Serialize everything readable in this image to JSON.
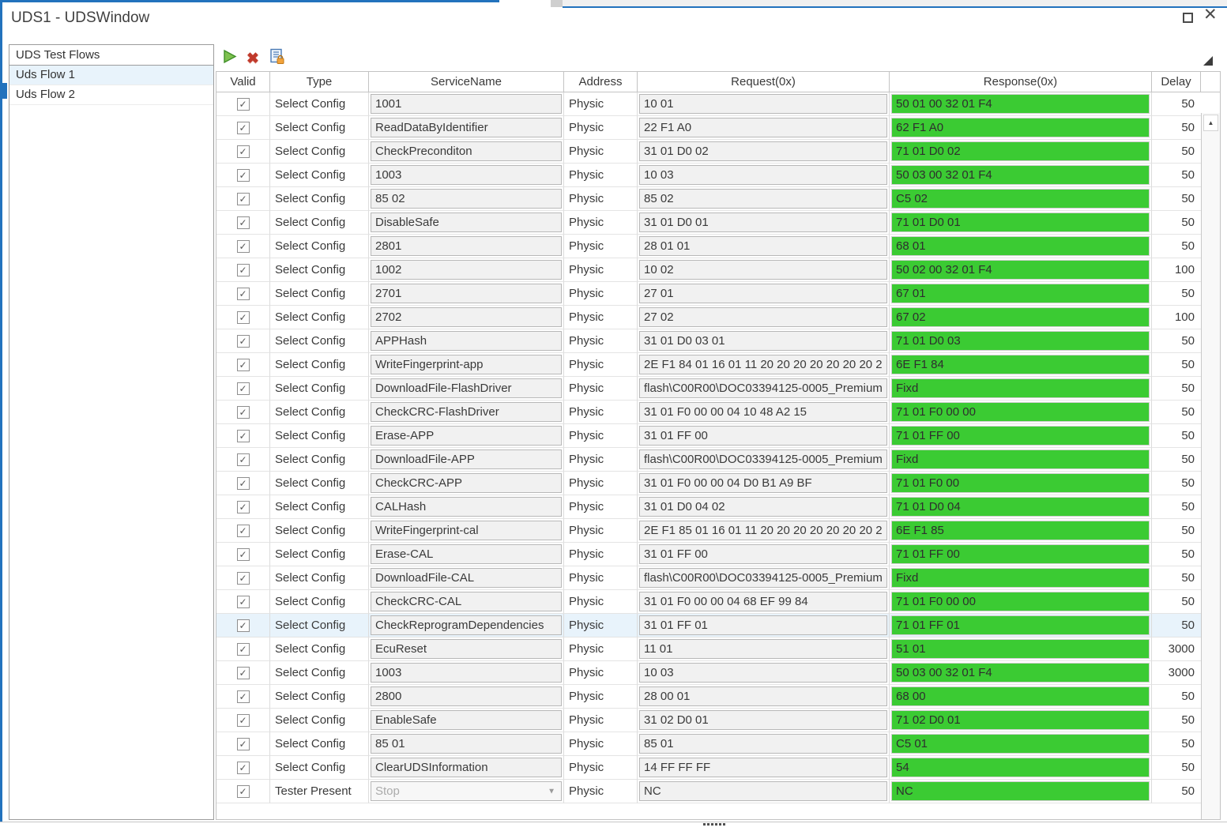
{
  "window": {
    "title": "UDS1 - UDSWindow",
    "close_glyph": "✕"
  },
  "sidebar": {
    "header": "UDS Test Flows",
    "items": [
      {
        "label": "Uds Flow 1",
        "selected": true
      },
      {
        "label": "Uds Flow 2",
        "selected": false
      }
    ]
  },
  "toolbar": {
    "run_icon": "play-triangle",
    "delete_glyph": "✖",
    "config_lock_icon": "document-with-lock"
  },
  "scrollbar": {
    "up_glyph": "▲",
    "down_glyph": "▼"
  },
  "colors": {
    "accent_blue": "#2272bd",
    "response_green": "#3bcb33",
    "selection_blue": "#e8f3fb"
  },
  "table": {
    "check_glyph": "✓",
    "dropdown_glyph": "▼",
    "columns": [
      "Valid",
      "Type",
      "ServiceName",
      "Address",
      "Request(0x)",
      "Response(0x)",
      "Delay"
    ],
    "rows": [
      {
        "type": "Select Config",
        "service": "1001",
        "address": "Physic",
        "request": "10 01",
        "response": "50 01 00 32 01 F4",
        "delay": "50"
      },
      {
        "type": "Select Config",
        "service": "ReadDataByIdentifier",
        "address": "Physic",
        "request": "22 F1 A0",
        "response": "62 F1 A0",
        "delay": "50"
      },
      {
        "type": "Select Config",
        "service": "CheckPreconditon",
        "address": "Physic",
        "request": "31 01 D0 02",
        "response": "71 01 D0 02",
        "delay": "50"
      },
      {
        "type": "Select Config",
        "service": "1003",
        "address": "Physic",
        "request": "10 03",
        "response": "50 03 00 32 01 F4",
        "delay": "50"
      },
      {
        "type": "Select Config",
        "service": "85 02",
        "address": "Physic",
        "request": "85 02",
        "response": "C5 02",
        "delay": "50"
      },
      {
        "type": "Select Config",
        "service": "DisableSafe",
        "address": "Physic",
        "request": "31 01 D0 01",
        "response": "71 01 D0 01",
        "delay": "50"
      },
      {
        "type": "Select Config",
        "service": "2801",
        "address": "Physic",
        "request": "28 01 01",
        "response": "68 01",
        "delay": "50"
      },
      {
        "type": "Select Config",
        "service": "1002",
        "address": "Physic",
        "request": "10 02",
        "response": "50 02 00 32 01 F4",
        "delay": "100"
      },
      {
        "type": "Select Config",
        "service": "2701",
        "address": "Physic",
        "request": "27 01",
        "response": "67 01",
        "delay": "50"
      },
      {
        "type": "Select Config",
        "service": "2702",
        "address": "Physic",
        "request": "27 02",
        "response": "67 02",
        "delay": "100"
      },
      {
        "type": "Select Config",
        "service": "APPHash",
        "address": "Physic",
        "request": "31 01 D0 03 01",
        "response": "71 01 D0 03",
        "delay": "50"
      },
      {
        "type": "Select Config",
        "service": "WriteFingerprint-app",
        "address": "Physic",
        "request": "2E F1 84 01 16 01 11 20 20 20 20 20 20 20 2",
        "response": "6E F1 84",
        "delay": "50"
      },
      {
        "type": "Select Config",
        "service": "DownloadFile-FlashDriver",
        "address": "Physic",
        "request": "flash\\C00R00\\DOC03394125-0005_Premium",
        "response": "Fixd",
        "delay": "50"
      },
      {
        "type": "Select Config",
        "service": "CheckCRC-FlashDriver",
        "address": "Physic",
        "request": "31 01 F0 00 00 04 10 48 A2 15",
        "response": "71 01 F0 00 00",
        "delay": "50"
      },
      {
        "type": "Select Config",
        "service": "Erase-APP",
        "address": "Physic",
        "request": "31 01 FF 00",
        "response": "71 01 FF 00",
        "delay": "50"
      },
      {
        "type": "Select Config",
        "service": "DownloadFile-APP",
        "address": "Physic",
        "request": "flash\\C00R00\\DOC03394125-0005_Premium",
        "response": "Fixd",
        "delay": "50"
      },
      {
        "type": "Select Config",
        "service": "CheckCRC-APP",
        "address": "Physic",
        "request": "31 01 F0 00 00 04 D0 B1 A9 BF",
        "response": "71 01 F0 00",
        "delay": "50"
      },
      {
        "type": "Select Config",
        "service": "CALHash",
        "address": "Physic",
        "request": "31 01 D0 04 02",
        "response": "71 01 D0 04",
        "delay": "50"
      },
      {
        "type": "Select Config",
        "service": "WriteFingerprint-cal",
        "address": "Physic",
        "request": "2E F1 85 01 16 01 11 20 20 20 20 20 20 20 2",
        "response": "6E F1 85",
        "delay": "50"
      },
      {
        "type": "Select Config",
        "service": "Erase-CAL",
        "address": "Physic",
        "request": "31 01 FF 00",
        "response": "71 01 FF 00",
        "delay": "50"
      },
      {
        "type": "Select Config",
        "service": "DownloadFile-CAL",
        "address": "Physic",
        "request": "flash\\C00R00\\DOC03394125-0005_Premium",
        "response": "Fixd",
        "delay": "50"
      },
      {
        "type": "Select Config",
        "service": "CheckCRC-CAL",
        "address": "Physic",
        "request": "31 01 F0 00 00 04 68 EF 99 84",
        "response": "71 01 F0 00 00",
        "delay": "50"
      },
      {
        "type": "Select Config",
        "service": "CheckReprogramDependencies",
        "address": "Physic",
        "request": "31 01 FF 01",
        "response": "71 01 FF 01",
        "delay": "50",
        "selected": true
      },
      {
        "type": "Select Config",
        "service": "EcuReset",
        "address": "Physic",
        "request": "11 01",
        "response": "51 01",
        "delay": "3000"
      },
      {
        "type": "Select Config",
        "service": "1003",
        "address": "Physic",
        "request": "10 03",
        "response": "50 03 00 32 01 F4",
        "delay": "3000"
      },
      {
        "type": "Select Config",
        "service": "2800",
        "address": "Physic",
        "request": "28 00 01",
        "response": "68 00",
        "delay": "50"
      },
      {
        "type": "Select Config",
        "service": "EnableSafe",
        "address": "Physic",
        "request": "31 02 D0 01",
        "response": "71 02 D0 01",
        "delay": "50"
      },
      {
        "type": "Select Config",
        "service": "85 01",
        "address": "Physic",
        "request": "85 01",
        "response": "C5 01",
        "delay": "50"
      },
      {
        "type": "Select Config",
        "service": "ClearUDSInformation",
        "address": "Physic",
        "request": "14 FF FF FF",
        "response": "54",
        "delay": "50"
      },
      {
        "type": "Tester Present",
        "service": "Stop",
        "address": "Physic",
        "request": "NC",
        "response": "NC",
        "delay": "50",
        "dropdown": true
      }
    ]
  }
}
